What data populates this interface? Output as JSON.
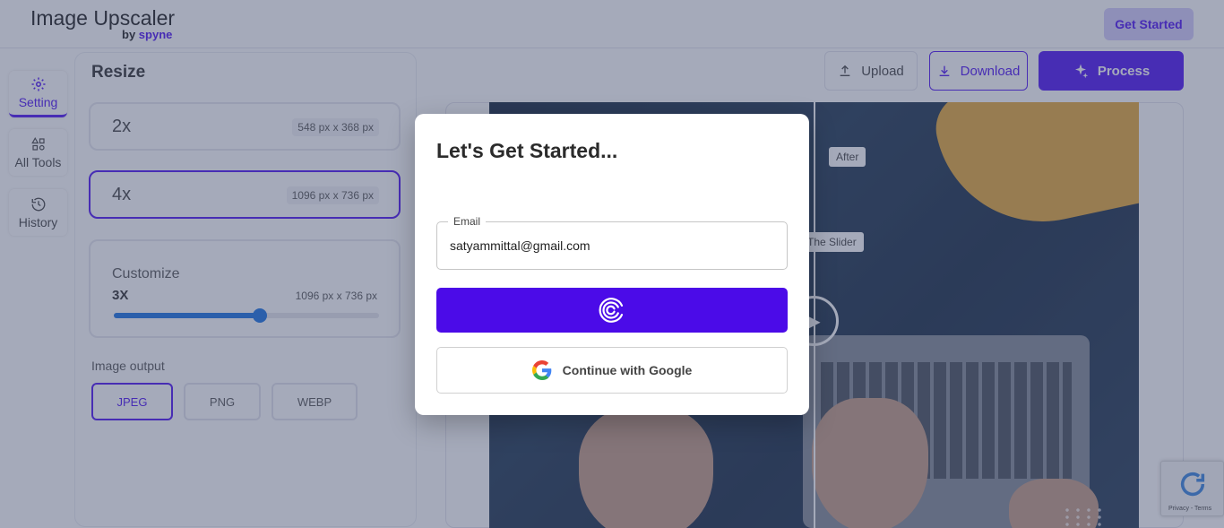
{
  "header": {
    "logo_title": "Image Upscaler",
    "logo_by": "by",
    "logo_brand": "spyne",
    "get_started_label": "Get Started"
  },
  "rail": {
    "items": [
      {
        "label": "Setting",
        "icon": "gear-icon",
        "active": true
      },
      {
        "label": "All Tools",
        "icon": "shapes-icon",
        "active": false
      },
      {
        "label": "History",
        "icon": "history-icon",
        "active": false
      }
    ]
  },
  "settings": {
    "title": "Resize",
    "options": [
      {
        "label": "2x",
        "dimensions": "548 px x 368 px",
        "selected": false
      },
      {
        "label": "4x",
        "dimensions": "1096 px x 736 px",
        "selected": true
      }
    ],
    "customize": {
      "title": "Customize",
      "value": "3X",
      "dimensions": "1096 px x 736 px",
      "slider_fraction": 0.55
    },
    "output_label": "Image output",
    "formats": [
      {
        "label": "JPEG",
        "selected": true
      },
      {
        "label": "PNG",
        "selected": false
      },
      {
        "label": "WEBP",
        "selected": false
      }
    ]
  },
  "toolbar": {
    "upload_label": "Upload",
    "download_label": "Download",
    "process_label": "Process"
  },
  "preview": {
    "after_tag": "After",
    "slider_tag": "The Slider"
  },
  "recaptcha": {
    "text": "Privacy - Terms"
  },
  "modal": {
    "title": "Let's Get Started...",
    "email_label": "Email",
    "email_value": "satyammittal@gmail.com",
    "google_label": "Continue with Google"
  },
  "colors": {
    "accent": "#5d28f5",
    "submit": "#4b0be8"
  }
}
